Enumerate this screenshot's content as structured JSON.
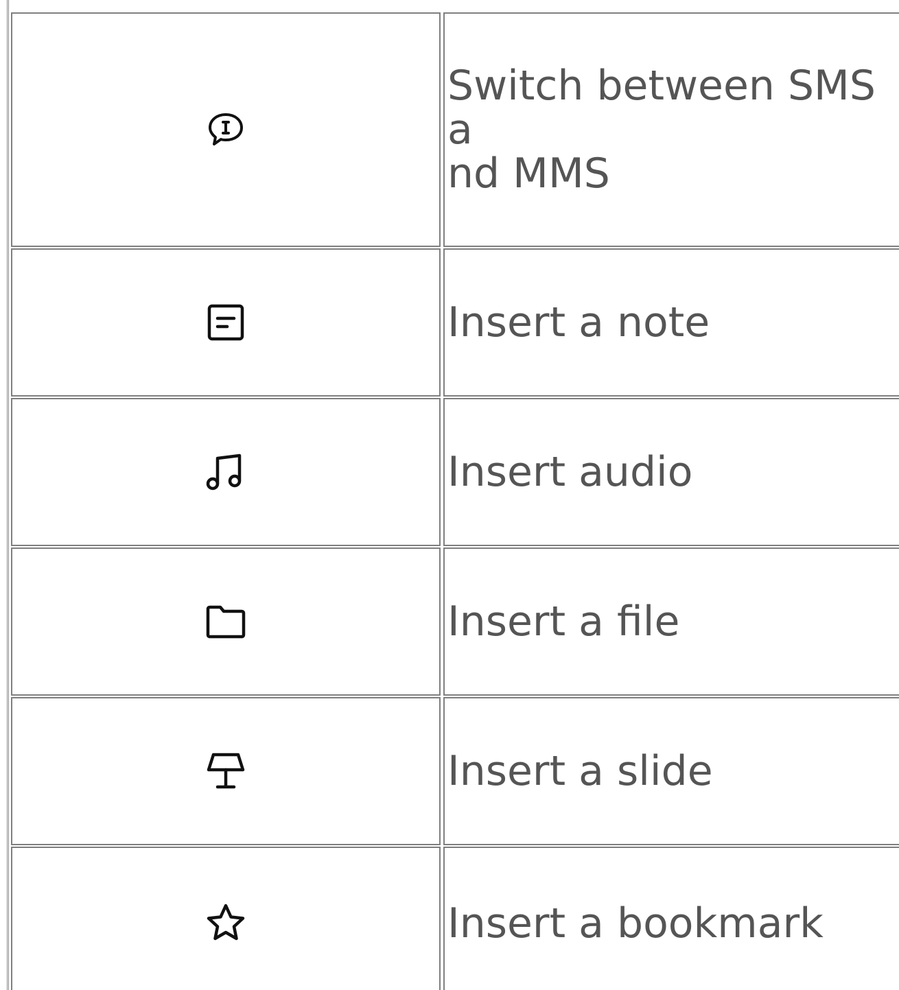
{
  "rows": [
    {
      "icon": "message-mode-icon",
      "label": "Switch between SMS a\nnd MMS"
    },
    {
      "icon": "note-icon",
      "label": "Insert a note"
    },
    {
      "icon": "music-note-icon",
      "label": "Insert audio"
    },
    {
      "icon": "folder-icon",
      "label": "Insert a file"
    },
    {
      "icon": "slide-presenter-icon",
      "label": "Insert a slide"
    },
    {
      "icon": "star-icon",
      "label": "Insert a bookmark"
    }
  ]
}
